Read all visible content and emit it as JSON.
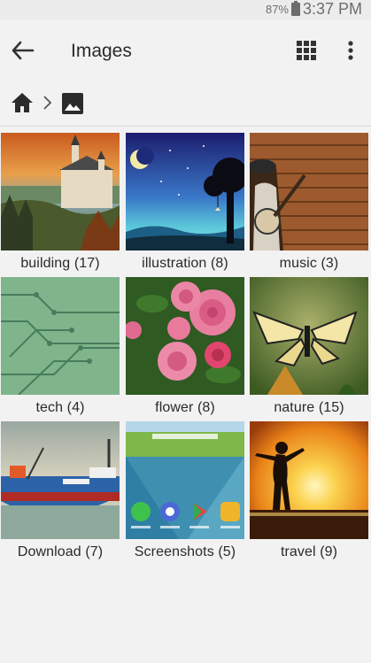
{
  "status": {
    "battery": "87%",
    "time": "3:37 PM"
  },
  "header": {
    "title": "Images"
  },
  "albums": [
    {
      "label": "building (17)"
    },
    {
      "label": "illustration (8)"
    },
    {
      "label": "music (3)"
    },
    {
      "label": "tech (4)"
    },
    {
      "label": "flower (8)"
    },
    {
      "label": "nature (15)"
    },
    {
      "label": "Download (7)"
    },
    {
      "label": "Screenshots (5)"
    },
    {
      "label": "travel (9)"
    }
  ],
  "icons": {
    "back": "arrow-back-icon",
    "view": "grid-view-icon",
    "more": "more-vert-icon",
    "home": "home-icon",
    "crumb_sep": "chevron-right-icon",
    "crumb_images": "image-icon"
  }
}
